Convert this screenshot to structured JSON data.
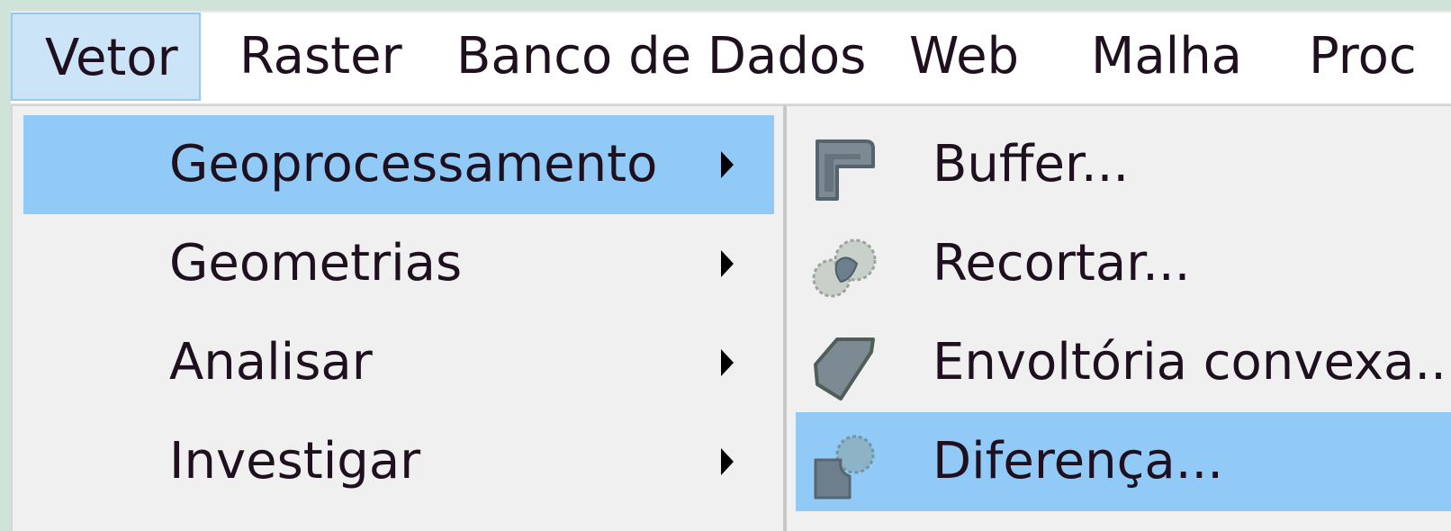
{
  "menubar": {
    "items": [
      {
        "label": "Vetor"
      },
      {
        "label": "Raster"
      },
      {
        "label": "Banco de Dados"
      },
      {
        "label": "Web"
      },
      {
        "label": "Malha"
      },
      {
        "label": "Proc"
      }
    ]
  },
  "vector_menu": {
    "items": [
      {
        "label": "Geoprocessamento",
        "has_submenu": true,
        "highlighted": true
      },
      {
        "label": "Geometrias",
        "has_submenu": true
      },
      {
        "label": "Analisar",
        "has_submenu": true
      },
      {
        "label": "Investigar",
        "has_submenu": true
      }
    ]
  },
  "geoprocessing_submenu": {
    "items": [
      {
        "label": "Buffer...",
        "icon": "buffer-icon"
      },
      {
        "label": "Recortar...",
        "icon": "clip-icon"
      },
      {
        "label": "Envoltória convexa...",
        "icon": "convex-hull-icon"
      },
      {
        "label": "Diferença...",
        "icon": "difference-icon",
        "highlighted": true
      }
    ]
  },
  "colors": {
    "highlight": "#91c9f7",
    "active_menubar": "#cce4f7",
    "menu_background": "#f0f0f0",
    "icon_gray": "#6d7e8c"
  }
}
